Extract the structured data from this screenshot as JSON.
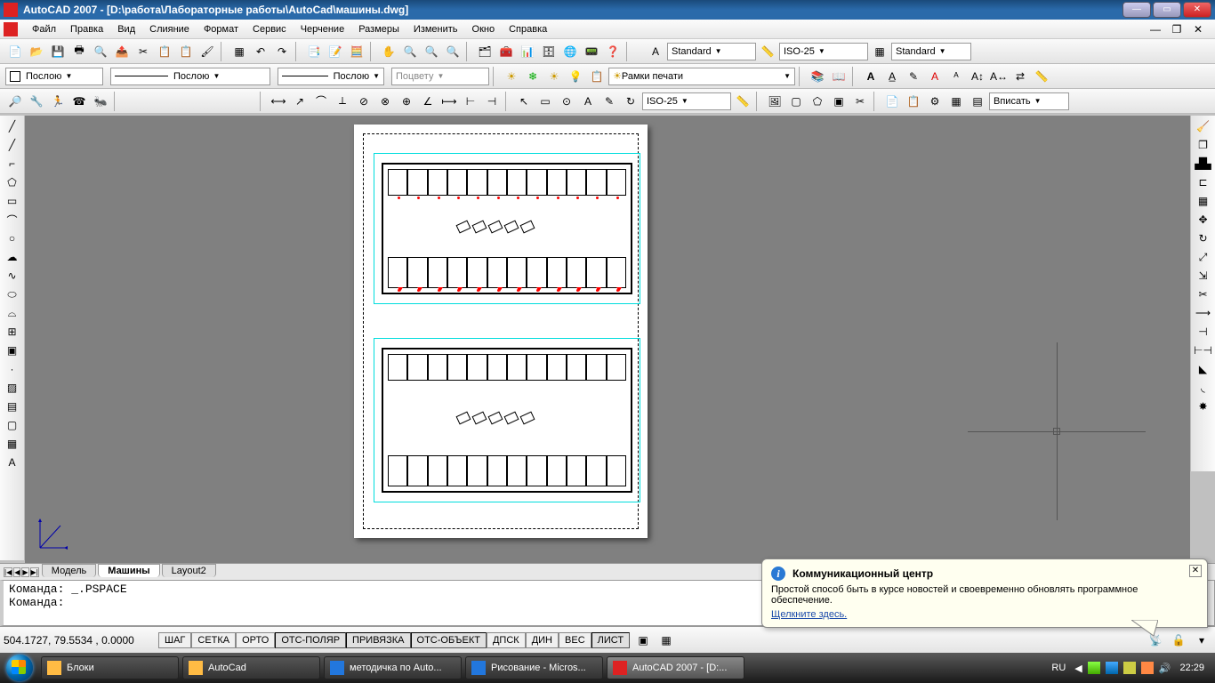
{
  "title": "AutoCAD 2007 - [D:\\работа\\Лабораторные работы\\AutoCad\\машины.dwg]",
  "menu": {
    "items": [
      "Файл",
      "Правка",
      "Вид",
      "Слияние",
      "Формат",
      "Сервис",
      "Черчение",
      "Размеры",
      "Изменить",
      "Окно",
      "Справка"
    ]
  },
  "toolbar2": {
    "style1": "Standard",
    "style2": "ISO-25",
    "style3": "Standard"
  },
  "toolbar3": {
    "layer": "Послою",
    "linetype": "Послою",
    "lineweight": "Послою",
    "plotstyle": "Поцвету",
    "layerpanel": "Рамки печати"
  },
  "toolbar4": {
    "dimstyle": "ISO-25",
    "scale": "Вписать"
  },
  "tabs": {
    "nav": [
      "|◀",
      "◀",
      "▶",
      "▶|"
    ],
    "items": [
      "Модель",
      "Машины",
      "Layout2"
    ],
    "active": 1
  },
  "command": {
    "line1": "Команда: _.PSPACE",
    "line2": "",
    "prompt": "Команда:"
  },
  "status": {
    "coords": "504.1727,  79.5534 , 0.0000",
    "buttons": [
      "ШАГ",
      "СЕТКА",
      "ОРТО",
      "ОТС-ПОЛЯР",
      "ПРИВЯЗКА",
      "ОТС-ОБЪЕКТ",
      "ДПСК",
      "ДИН",
      "ВЕС",
      "ЛИСТ"
    ],
    "active": [
      3,
      4,
      5,
      9
    ]
  },
  "balloon": {
    "title": "Коммуникационный центр",
    "body": "Простой способ быть в курсе новостей и своевременно обновлять программное обеспечение.",
    "link": "Щелкните здесь."
  },
  "taskbar": {
    "items": [
      "Блоки",
      "AutoCad",
      "методичка по Auto...",
      "Рисование - Micros...",
      "AutoCAD 2007 - [D:..."
    ],
    "active": 4,
    "lang": "RU",
    "clock": "22:29"
  }
}
